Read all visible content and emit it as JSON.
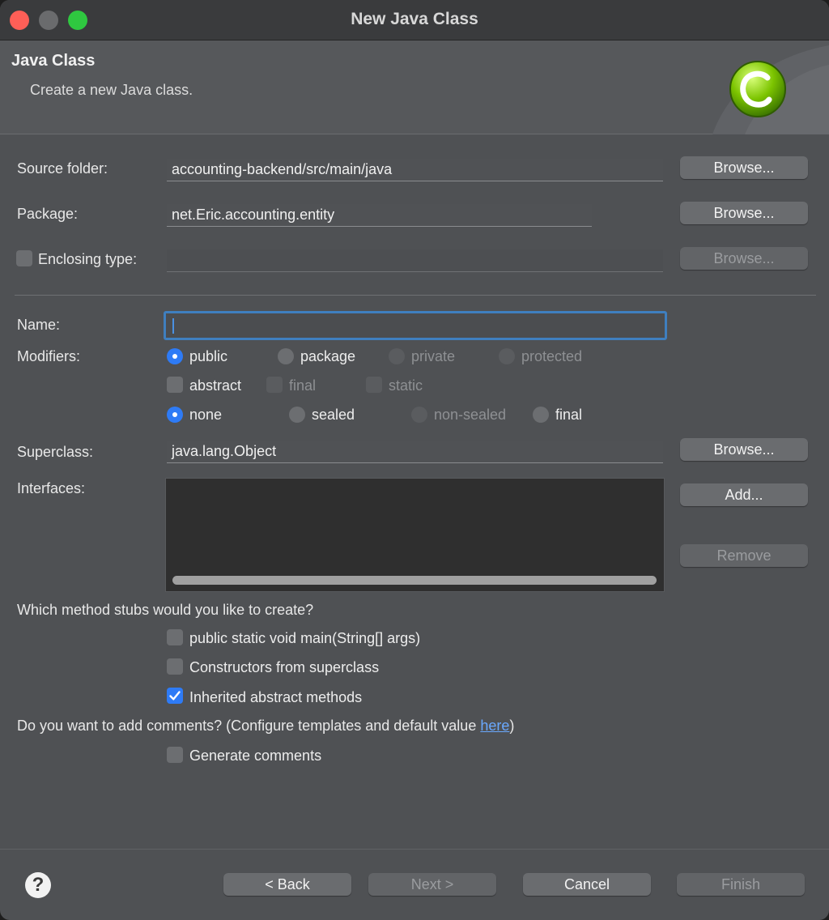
{
  "window": {
    "title": "New Java Class"
  },
  "banner": {
    "title": "Java Class",
    "description": "Create a new Java class.",
    "icon_letter": "C"
  },
  "source_folder": {
    "label": "Source folder:",
    "value": "accounting-backend/src/main/java",
    "browse": "Browse..."
  },
  "package": {
    "label": "Package:",
    "value": "net.Eric.accounting.entity",
    "browse": "Browse..."
  },
  "enclosing": {
    "label": "Enclosing type:",
    "value": "",
    "browse": "Browse...",
    "checked": false
  },
  "name": {
    "label": "Name:",
    "value": ""
  },
  "modifiers": {
    "label": "Modifiers:",
    "access": [
      "public",
      "package",
      "private",
      "protected"
    ],
    "access_selected": "public",
    "flags": [
      "abstract",
      "final",
      "static"
    ],
    "sealing": [
      "none",
      "sealed",
      "non-sealed",
      "final"
    ],
    "sealing_selected": "none"
  },
  "superclass": {
    "label": "Superclass:",
    "value": "java.lang.Object",
    "browse": "Browse..."
  },
  "interfaces": {
    "label": "Interfaces:",
    "add": "Add...",
    "remove": "Remove",
    "items": []
  },
  "stubs": {
    "question": "Which method stubs would you like to create?",
    "options": [
      {
        "label": "public static void main(String[] args)",
        "checked": false
      },
      {
        "label": "Constructors from superclass",
        "checked": false
      },
      {
        "label": "Inherited abstract methods",
        "checked": true
      }
    ]
  },
  "comments": {
    "question_prefix": "Do you want to add comments? (Configure templates and default value ",
    "link": "here",
    "question_suffix": ")",
    "option": {
      "label": "Generate comments",
      "checked": false
    }
  },
  "footer": {
    "help": "?",
    "back": "< Back",
    "next": "Next >",
    "cancel": "Cancel",
    "finish": "Finish"
  },
  "colors": {
    "accent": "#2e7bf6",
    "focus_ring": "#3f7fbf",
    "close": "#ff5f57",
    "maximize": "#2fc840",
    "icon_green": "#7cc400"
  }
}
